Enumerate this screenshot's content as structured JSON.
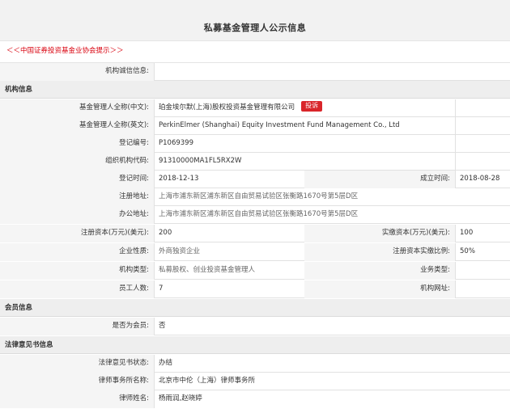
{
  "page": {
    "title": "私募基金管理人公示信息",
    "notice_link": "＜＜中国证券投资基金业协会提示＞＞"
  },
  "integrity": {
    "label": "机构诚信信息:",
    "value": ""
  },
  "sections": {
    "institution": "机构信息",
    "member": "会员信息",
    "legal": "法律意见书信息"
  },
  "institution": {
    "name_cn": {
      "label": "基金管理人全称(中文):",
      "value": "珀金埃尔默(上海)股权投资基金管理有限公司",
      "complain": "投诉"
    },
    "name_en": {
      "label": "基金管理人全称(英文):",
      "value": "PerkinElmer (Shanghai) Equity Investment Fund Management Co., Ltd"
    },
    "reg_no": {
      "label": "登记编号:",
      "value": "P1069399"
    },
    "org_code": {
      "label": "组织机构代码:",
      "value": "91310000MA1FL5RX2W"
    },
    "reg_date": {
      "label": "登记时间:",
      "value": "2018-12-13"
    },
    "found_date": {
      "label": "成立时间:",
      "value": "2018-08-28"
    },
    "reg_addr": {
      "label": "注册地址:",
      "value": "上海市浦东新区浦东新区自由贸易试验区张衡路1670号第5层D区"
    },
    "office_addr": {
      "label": "办公地址:",
      "value": "上海市浦东新区浦东新区自由贸易试验区张衡路1670号第5层D区"
    },
    "reg_capital": {
      "label": "注册资本(万元)(美元):",
      "value": "200"
    },
    "paid_capital": {
      "label": "实缴资本(万元)(美元):",
      "value": "100"
    },
    "nature": {
      "label": "企业性质:",
      "value": "外商独资企业"
    },
    "paid_ratio": {
      "label": "注册资本实缴比例:",
      "value": "50%"
    },
    "org_type": {
      "label": "机构类型:",
      "value": "私募股权、创业投资基金管理人"
    },
    "business_type": {
      "label": "业务类型:",
      "value": ""
    },
    "staff": {
      "label": "员工人数:",
      "value": "7"
    },
    "website": {
      "label": "机构网址:",
      "value": ""
    }
  },
  "member": {
    "is_member": {
      "label": "是否为会员:",
      "value": "否"
    }
  },
  "legal": {
    "status": {
      "label": "法律意见书状态:",
      "value": "办结"
    },
    "law_firm": {
      "label": "律师事务所名称:",
      "value": "北京市中伦（上海）律师事务所"
    },
    "lawyers": {
      "label": "律师姓名:",
      "value": "杨雨润,赵晓婷"
    }
  },
  "colors": {
    "accent_red": "#d9000d",
    "complain_bg": "#d9252a",
    "label_bg": "#f5f5f5",
    "section_bg": "#eeeeee"
  }
}
